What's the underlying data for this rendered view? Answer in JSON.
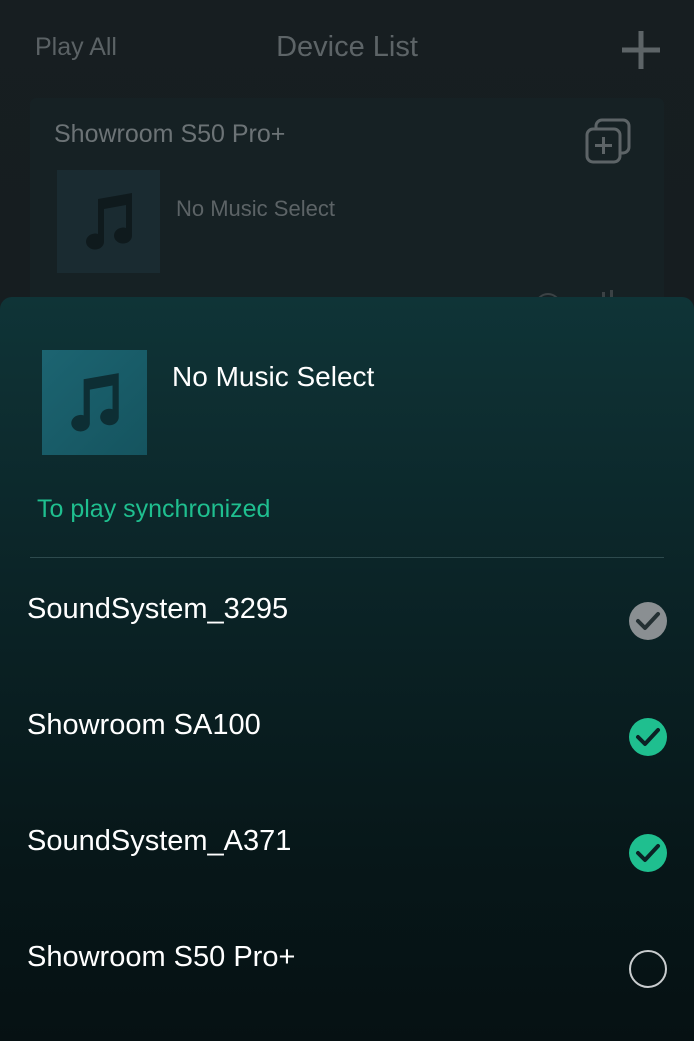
{
  "header": {
    "play_all": "Play All",
    "title": "Device List",
    "add_icon": "plus-icon"
  },
  "device_card": {
    "name": "Showroom S50 Pro+",
    "group_icon": "group-add-icon",
    "now_playing": "No Music Select",
    "thumbnail_icon": "music-note-icon"
  },
  "sheet": {
    "now_playing": "No Music Select",
    "thumbnail_icon": "music-note-icon",
    "sync_label": "To play synchronized",
    "devices": [
      {
        "name": "SoundSystem_3295",
        "state": "checked-disabled"
      },
      {
        "name": "Showroom SA100",
        "state": "checked"
      },
      {
        "name": "SoundSystem_A371",
        "state": "checked"
      },
      {
        "name": "Showroom S50 Pro+",
        "state": "unchecked"
      }
    ]
  },
  "colors": {
    "accent": "#1fbf8f",
    "check_disabled": "#8a8f92",
    "sheet_top": "#0f3437",
    "sheet_bottom": "#061113"
  }
}
